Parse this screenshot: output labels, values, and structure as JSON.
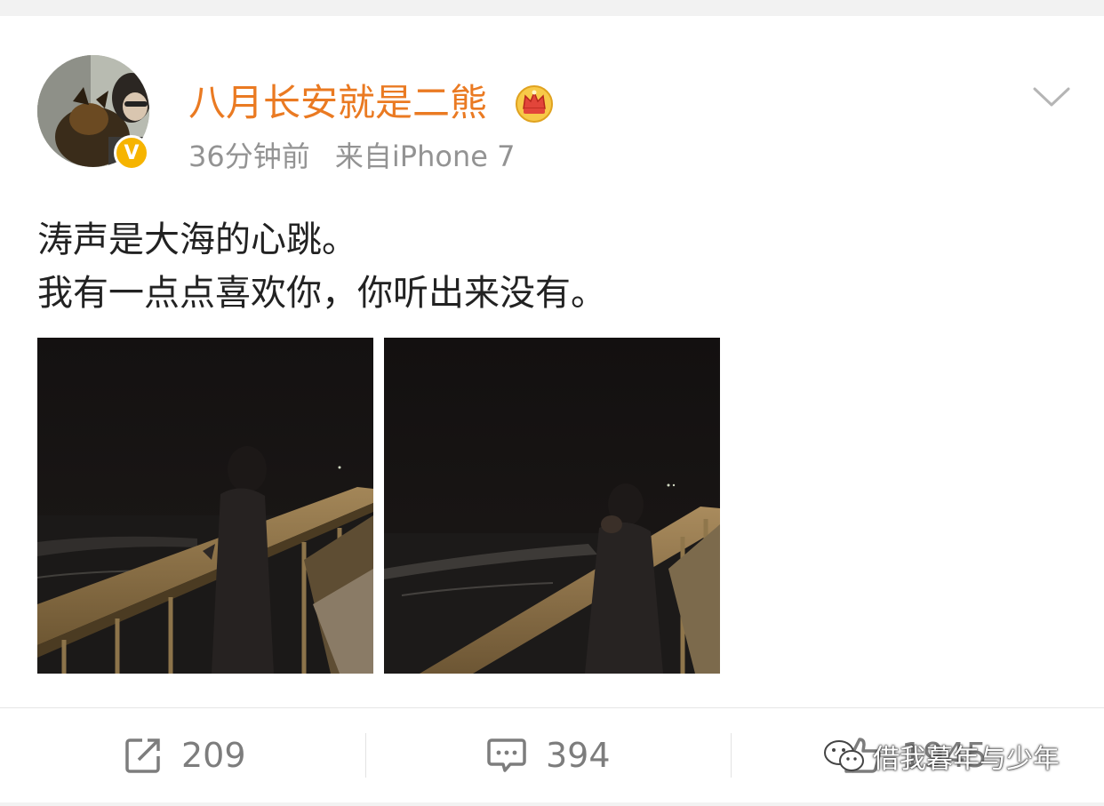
{
  "post": {
    "username": "八月长安就是二熊",
    "time": "36分钟前",
    "source": "来自iPhone 7",
    "verified_badge": "V",
    "text_lines": [
      "涛声是大海的心跳。",
      "我有一点点喜欢你，你听出来没有。"
    ]
  },
  "actions": {
    "repost_count": "209",
    "comment_count": "394",
    "like_count": "1945"
  },
  "watermark": {
    "text": "借我暮年与少年"
  },
  "icons": {
    "crown": "crown-icon",
    "chevron": "chevron-down-icon",
    "repost": "repost-icon",
    "comment": "comment-icon",
    "like": "like-icon",
    "wechat": "wechat-icon"
  },
  "colors": {
    "username": "#ea7a22",
    "meta": "#939393",
    "verified": "#f6b400",
    "text": "#222222",
    "action": "#7d7d7d"
  }
}
